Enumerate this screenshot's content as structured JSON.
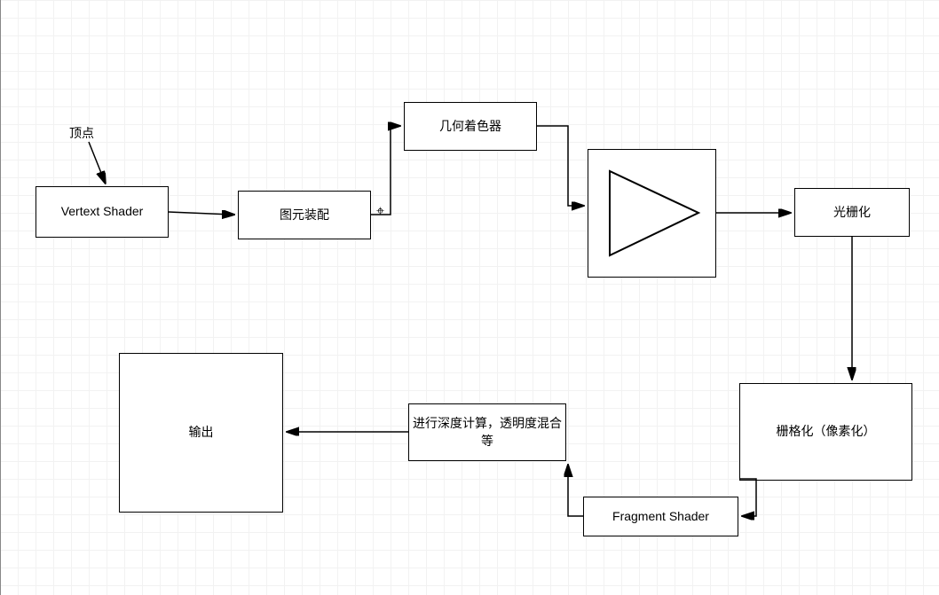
{
  "diagram": {
    "label_vertex": "顶点",
    "n1": "Vertext Shader",
    "n2": "图元装配",
    "n3": "几何着色器",
    "n4_triangle": "",
    "n5": "光栅化",
    "n6": "栅格化（像素化）",
    "n7": "Fragment Shader",
    "n8": "进行深度计算，透明度混合等",
    "n9": "输出"
  }
}
